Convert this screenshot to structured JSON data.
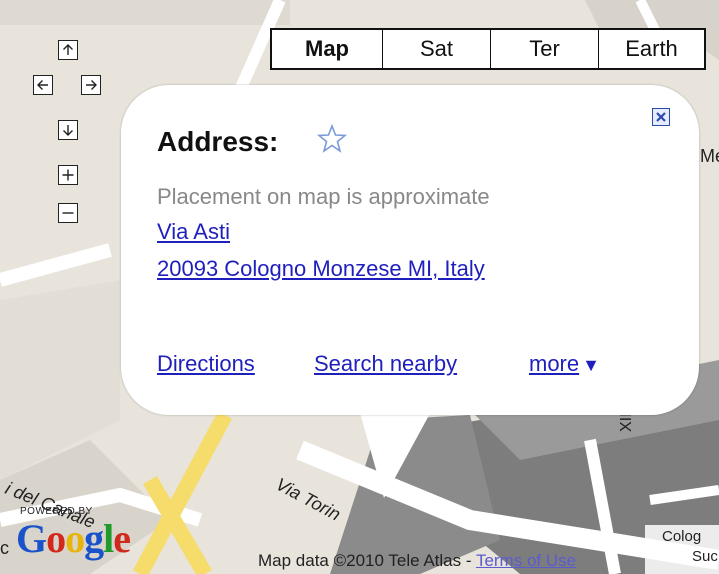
{
  "map_types": [
    {
      "label": "Map",
      "active": true
    },
    {
      "label": "Sat",
      "active": false
    },
    {
      "label": "Ter",
      "active": false
    },
    {
      "label": "Earth",
      "active": false
    }
  ],
  "controls": {
    "pan_up": "up-arrow-icon",
    "pan_left": "left-arrow-icon",
    "pan_right": "right-arrow-icon",
    "pan_down": "down-arrow-icon",
    "zoom_in": "plus-icon",
    "zoom_out": "minus-icon"
  },
  "info_window": {
    "title": "Address:",
    "note": "Placement on map is approximate",
    "street": "Via Asti",
    "city_line": "20093 Cologno Monzese MI, Italy",
    "links": {
      "directions": "Directions",
      "search_nearby": "Search nearby",
      "more": "more"
    },
    "close_icon": "close-icon",
    "star_icon": "star-icon"
  },
  "map_labels": {
    "road": "Via Torin",
    "left_road": "i del Canale",
    "roman_numeral": "XIII",
    "right_top": "Me",
    "bottom_right_1": "Colog",
    "bottom_right_2": "Suc",
    "left_cut": "c"
  },
  "footer": {
    "powered_by": "POWERED BY",
    "logo": "Google",
    "copyright": "Map data ©2010 Tele Atlas - ",
    "terms": "Terms of Use"
  },
  "colors": {
    "link": "#1f1fbe",
    "road_yellow": "#f5dc6b",
    "land": "#e8e4dc"
  }
}
